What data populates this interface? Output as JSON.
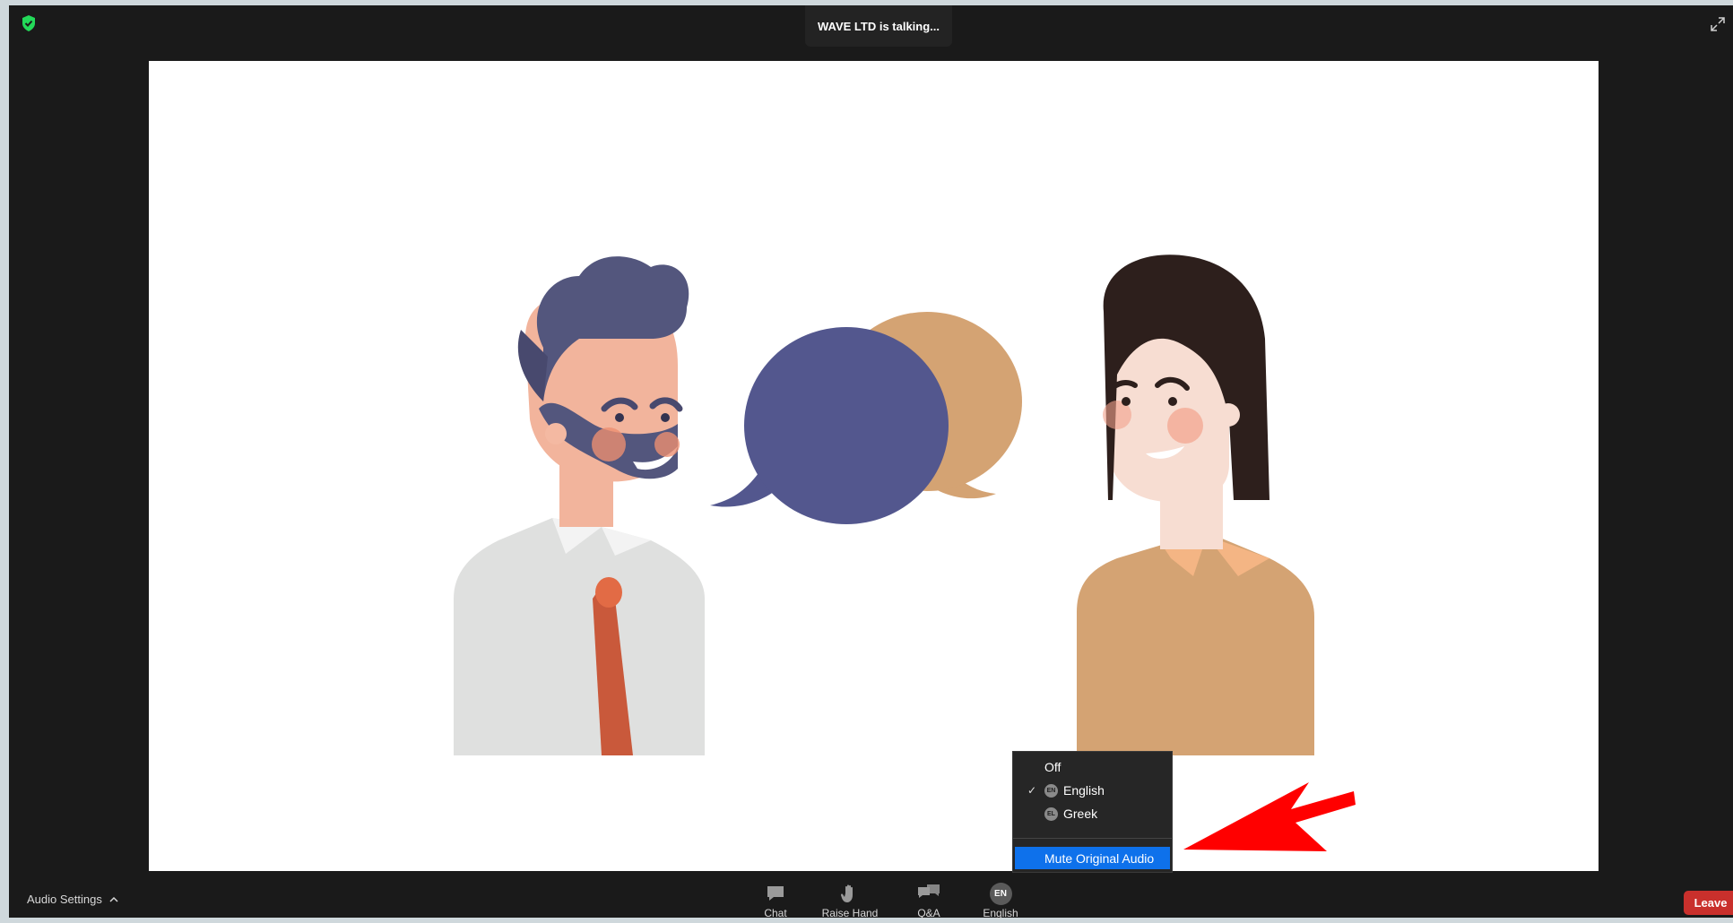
{
  "header": {
    "talking_text": "WAVE LTD is talking..."
  },
  "colors": {
    "window_bg": "#1a1a1a",
    "accent_blue": "#0e71eb",
    "leave_red": "#c9302c",
    "shield_green": "#23d959"
  },
  "interpretation_menu": {
    "items": [
      {
        "label": "Off",
        "checked": false,
        "badge": ""
      },
      {
        "label": "English",
        "checked": true,
        "badge": "EN"
      },
      {
        "label": "Greek",
        "checked": false,
        "badge": "EL"
      }
    ],
    "mute_label": "Mute Original Audio",
    "check_glyph": "✓"
  },
  "toolbar": {
    "audio_settings": "Audio Settings",
    "chat": "Chat",
    "raise_hand": "Raise Hand",
    "qa": "Q&A",
    "language": "English",
    "language_badge": "EN",
    "leave": "Leave"
  },
  "icons": [
    "shield-icon",
    "expand-icon",
    "chat-icon",
    "raise-hand-icon",
    "qa-icon",
    "chevron-up-icon",
    "red-arrow-icon"
  ]
}
